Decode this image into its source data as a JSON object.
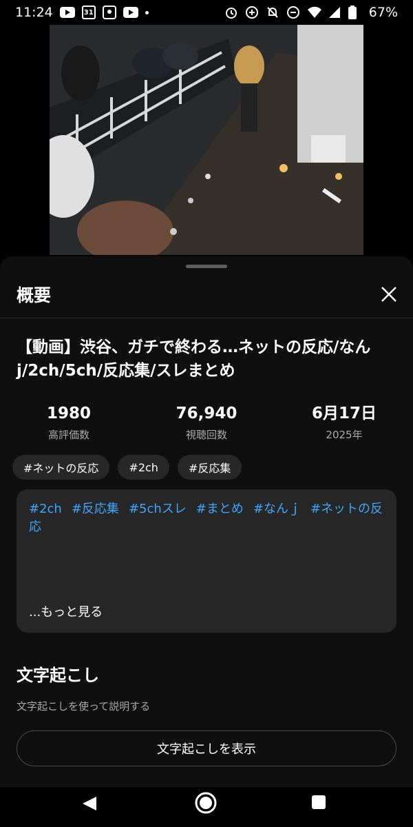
{
  "status_bar": {
    "time": "11:24",
    "calendar_day": "31",
    "battery": "67%"
  },
  "sheet": {
    "title": "概要",
    "video_title": "【動画】渋谷、ガチで終わる…ネットの反応/なんj/2ch/5ch/反応集/スレまとめ",
    "stats": [
      {
        "value": "1980",
        "label": "高評価数"
      },
      {
        "value": "76,940",
        "label": "視聴回数"
      },
      {
        "value": "6月17日",
        "label": "2025年"
      }
    ],
    "chips": [
      "#ネットの反応",
      "#2ch",
      "#反応集"
    ],
    "description": {
      "tags": [
        "#2ch",
        "#反応集",
        "#5chスレ",
        "#まとめ",
        "#なんｊ",
        "#ネットの反応"
      ],
      "more": "...もっと見る"
    },
    "transcript": {
      "title": "文字起こし",
      "desc": "文字起こしを使って説明する",
      "button": "文字起こしを表示"
    }
  },
  "icons": {
    "status": [
      "youtube-icon",
      "calendar-icon",
      "app-icon",
      "youtube-icon",
      "alarm-icon",
      "data-saver-icon",
      "mute-icon",
      "dnd-icon",
      "wifi-icon",
      "signal-icon",
      "battery-icon"
    ],
    "close": "close-icon",
    "nav": [
      "back-icon",
      "home-icon",
      "recents-icon"
    ]
  },
  "colors": {
    "background": "#0f0f0f",
    "surface": "#272727",
    "link": "#3ea6ff"
  }
}
